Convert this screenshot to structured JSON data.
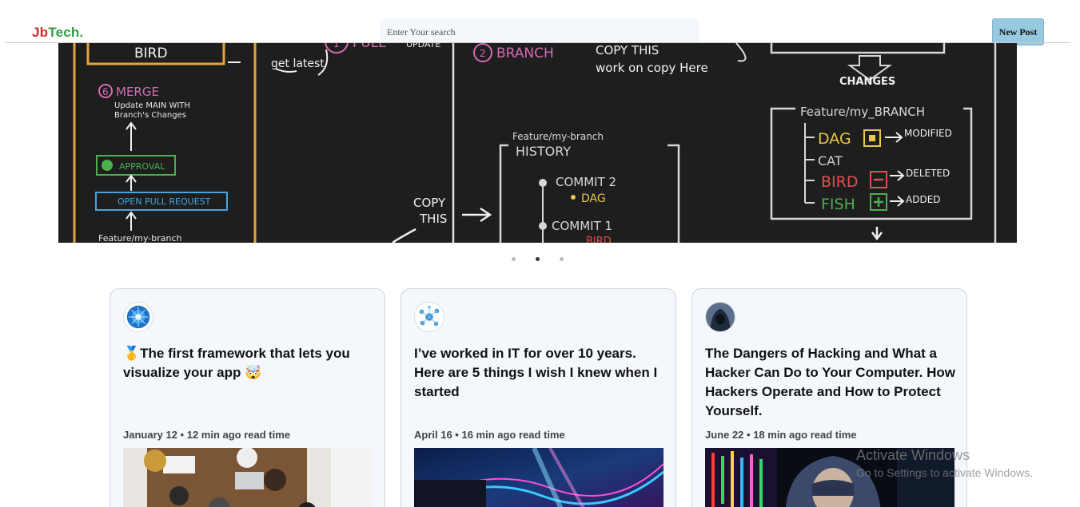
{
  "header": {
    "logo_part1": "Jb",
    "logo_part2": "Tech.",
    "search_placeholder": "Enter Your search",
    "new_post_label": "New Post"
  },
  "hero": {
    "slide_labels": {
      "bird": "BIRD",
      "get_latest": "get latest",
      "merge": "MERGE",
      "merge_sub1": "Update MAIN WITH",
      "merge_sub2": "Branch's Changes",
      "approval": "APPROVAL",
      "open_pr": "OPEN PULL REQUEST",
      "feature_branch_bottom": "Feature/my-branch",
      "pull": "PULL",
      "update": "UPDATE",
      "branch": "BRANCH",
      "copy_this": "COPY THIS",
      "work_on_copy": "work on copy Here",
      "copy_this_2a": "COPY",
      "copy_this_2b": "THIS",
      "history_title": "Feature/my-branch",
      "history": "HISTORY",
      "commit2": "COMMIT 2",
      "dag": "DAG",
      "commit1": "COMMIT 1",
      "bird_small": "BIRD",
      "changes": "CHANGES",
      "feature_box": "Feature/my_BRANCH",
      "dag_big": "DAG",
      "modified": "MODIFIED",
      "cat": "CAT",
      "bird_big": "BIRD",
      "deleted": "DELETED",
      "fish": "FISH",
      "added": "ADDED",
      "num_merge": "6",
      "num_pull": "1",
      "num_branch": "2"
    },
    "carousel": {
      "slide_count": 3,
      "active_index": 1
    }
  },
  "cards": [
    {
      "title": "🥇The first framework that lets you visualize your app 🤯",
      "meta": "January 12 • 12 min ago read time",
      "avatar_icon": "globe-network-icon",
      "image_subject": "team meeting photo"
    },
    {
      "title": "I’ve worked in IT for over 10 years. Here are 5 things I wish I knew when I started",
      "meta": "April 16 • 16 min ago read time",
      "avatar_icon": "network-nodes-icon",
      "image_subject": "neon data waves photo"
    },
    {
      "title": "The Dangers of Hacking and What a Hacker Can Do to Your Computer. How Hackers Operate and How to Protect Yourself.",
      "meta": "June 22 • 18 min ago read time",
      "avatar_icon": "hooded-hacker-icon",
      "image_subject": "hooded hacker photo"
    }
  ],
  "watermark": {
    "line1": "Activate Windows",
    "line2": "Go to Settings to activate Windows."
  },
  "colors": {
    "logo_red": "#d32f2f",
    "logo_green": "#2e9e44",
    "new_post_bg": "#97c9e0",
    "card_bg": "#f4f7fc",
    "hero_bg": "#1c1c1c"
  }
}
